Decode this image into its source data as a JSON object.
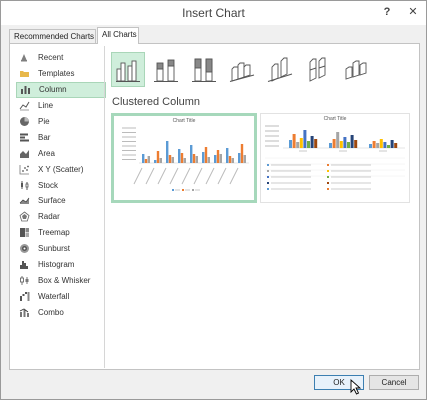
{
  "dialog": {
    "title": "Insert Chart",
    "help_label": "?",
    "close_label": "✕"
  },
  "tabs": [
    {
      "label": "Recommended Charts"
    },
    {
      "label": "All Charts"
    }
  ],
  "sidebar": {
    "items": [
      {
        "label": "Recent",
        "icon": "recent-icon"
      },
      {
        "label": "Templates",
        "icon": "folder-icon"
      },
      {
        "label": "Column",
        "icon": "column-chart-icon"
      },
      {
        "label": "Line",
        "icon": "line-chart-icon"
      },
      {
        "label": "Pie",
        "icon": "pie-chart-icon"
      },
      {
        "label": "Bar",
        "icon": "bar-chart-icon"
      },
      {
        "label": "Area",
        "icon": "area-chart-icon"
      },
      {
        "label": "X Y (Scatter)",
        "icon": "scatter-chart-icon"
      },
      {
        "label": "Stock",
        "icon": "stock-chart-icon"
      },
      {
        "label": "Surface",
        "icon": "surface-chart-icon"
      },
      {
        "label": "Radar",
        "icon": "radar-chart-icon"
      },
      {
        "label": "Treemap",
        "icon": "treemap-chart-icon"
      },
      {
        "label": "Sunburst",
        "icon": "sunburst-chart-icon"
      },
      {
        "label": "Histogram",
        "icon": "histogram-chart-icon"
      },
      {
        "label": "Box & Whisker",
        "icon": "box-whisker-chart-icon"
      },
      {
        "label": "Waterfall",
        "icon": "waterfall-chart-icon"
      },
      {
        "label": "Combo",
        "icon": "combo-chart-icon"
      }
    ],
    "selected_index": 2
  },
  "main": {
    "section_title": "Clustered Column",
    "preview_titles": [
      "Chart Title",
      "Chart Title"
    ],
    "selected_subtype_index": 0
  },
  "footer": {
    "ok_label": "OK",
    "cancel_label": "Cancel"
  },
  "colors": {
    "selection_fill": "#cfeedb",
    "selection_border": "#a6d8bb",
    "series_blue": "#5b9bd5",
    "series_orange": "#ed7d31",
    "series_gray": "#a5a5a5"
  }
}
